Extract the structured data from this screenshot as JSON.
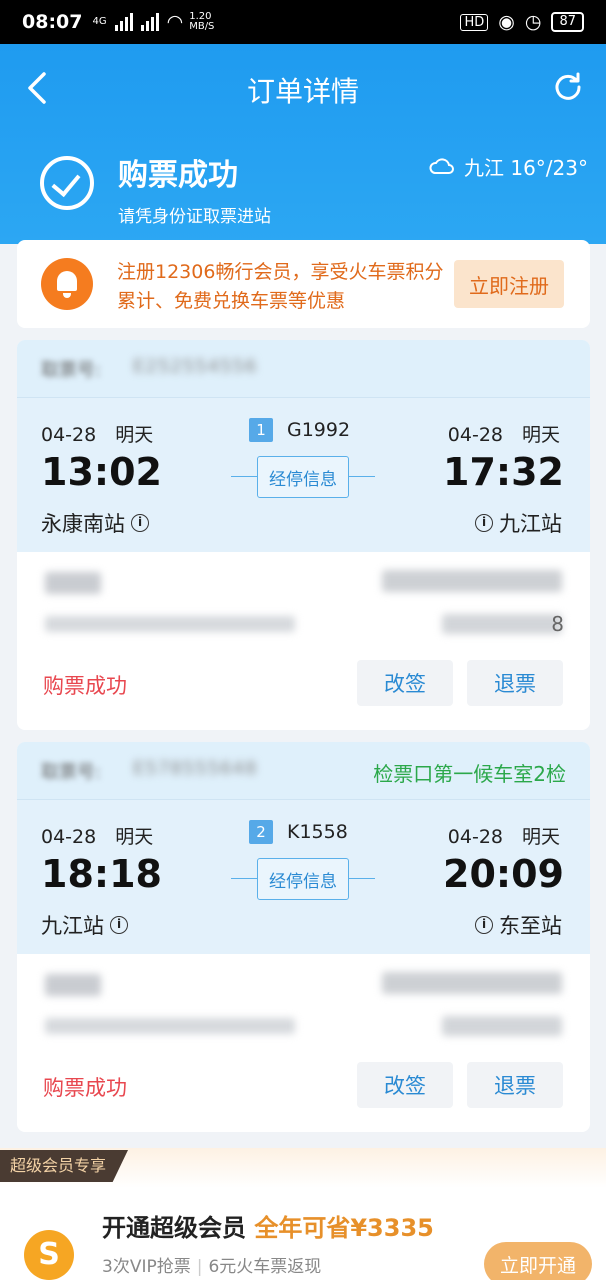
{
  "status_bar": {
    "time": "08:07",
    "net_small": "4G",
    "speed": "1.20",
    "speed_unit": "MB/S",
    "battery": "87"
  },
  "header": {
    "title": "订单详情",
    "status_title": "购票成功",
    "status_sub": "请凭身份证取票进站",
    "weather": "九江 16°/23°"
  },
  "promo": {
    "text": "注册12306畅行会员，享受火车票积分累计、免费兑换车票等优惠",
    "button": "立即注册"
  },
  "tickets": [
    {
      "label": "取票号:",
      "number": "E252554556",
      "gate": "",
      "dep_date": "04-28　明天",
      "arr_date": "04-28　明天",
      "dep_time": "13:02",
      "arr_time": "17:32",
      "dep_station": "永康南站",
      "arr_station": "九江站",
      "train_index": "1",
      "train_no": "G1992",
      "stops_btn": "经停信息",
      "price_tail": "8",
      "status": "购票成功",
      "change": "改签",
      "refund": "退票"
    },
    {
      "label": "取票号:",
      "number": "E578555648",
      "gate": "检票口第一候车室2检",
      "dep_date": "04-28　明天",
      "arr_date": "04-28　明天",
      "dep_time": "18:18",
      "arr_time": "20:09",
      "dep_station": "九江站",
      "arr_station": "东至站",
      "train_index": "2",
      "train_no": "K1558",
      "stops_btn": "经停信息",
      "price_tail": "",
      "status": "购票成功",
      "change": "改签",
      "refund": "退票"
    }
  ],
  "vip": {
    "tag": "超级会员专享",
    "title": "开通超级会员",
    "highlight": "全年可省¥3335",
    "sub_1": "3次VIP抢票",
    "sub_2": "6元火车票返现",
    "button": "立即开通",
    "logo": "S"
  }
}
